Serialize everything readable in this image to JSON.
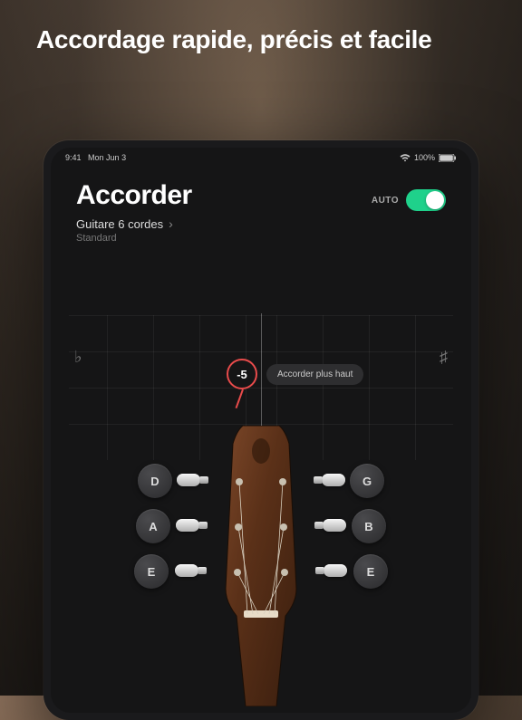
{
  "headline": "Accordage rapide, précis et facile",
  "status_bar": {
    "time": "9:41",
    "date": "Mon Jun 3",
    "battery": "100%"
  },
  "header": {
    "title": "Accorder",
    "auto_label": "AUTO",
    "auto_on": true
  },
  "instrument": {
    "name": "Guitare 6 cordes",
    "tuning": "Standard"
  },
  "tuner": {
    "flat_symbol": "♭",
    "sharp_symbol": "♯",
    "cents": "-5",
    "hint": "Accorder plus haut",
    "indicator_color": "#e84b4b"
  },
  "strings": {
    "left": [
      "D",
      "A",
      "E"
    ],
    "right": [
      "G",
      "B",
      "E"
    ]
  }
}
